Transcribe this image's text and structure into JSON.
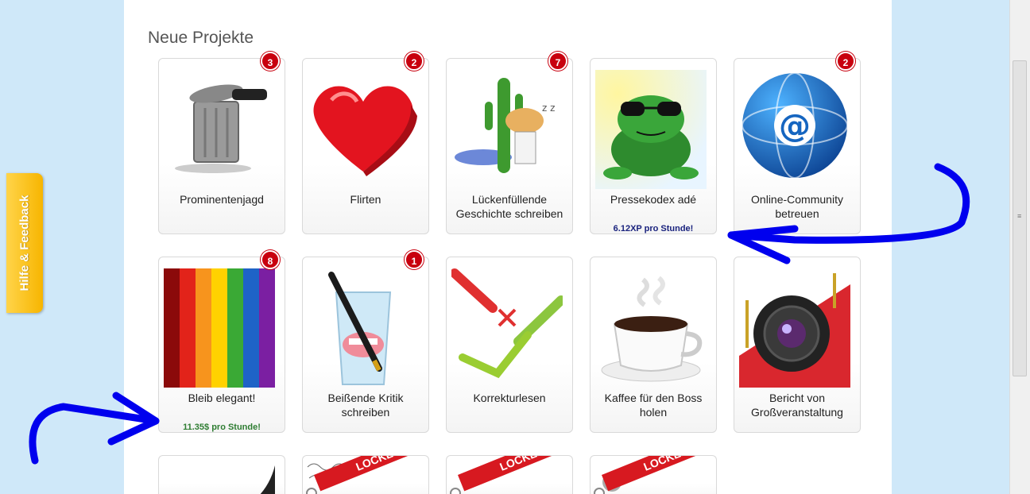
{
  "section_title": "Neue Projekte",
  "feedback_tab": "Hilfe & Feedback",
  "rows": [
    [
      {
        "title": "Prominentenjagd",
        "badge": "3",
        "rate": ""
      },
      {
        "title": "Flirten",
        "badge": "2",
        "rate": ""
      },
      {
        "title": "Lückenfüllende Geschichte schreiben",
        "badge": "7",
        "rate": ""
      },
      {
        "title": "Pressekodex adé",
        "badge": "",
        "rate": "6.12XP pro Stunde!"
      },
      {
        "title": "Online-Community betreuen",
        "badge": "2",
        "rate": ""
      }
    ],
    [
      {
        "title": "Bleib elegant!",
        "badge": "8",
        "rate": "11.35$ pro Stunde!"
      },
      {
        "title": "Beißende Kritik schreiben",
        "badge": "1",
        "rate": ""
      },
      {
        "title": "Korrekturlesen",
        "badge": "",
        "rate": ""
      },
      {
        "title": "Kaffee für den Boss holen",
        "badge": "",
        "rate": ""
      },
      {
        "title": "Bericht von Großveranstaltung",
        "badge": "",
        "rate": ""
      }
    ]
  ],
  "locked_label": "LOCKED!",
  "colors": {
    "badge": "#c8000e",
    "xp_rate": "#1a237e",
    "money_rate": "#2e7d32",
    "feedback": "#f7b500",
    "locked": "#d71920"
  }
}
